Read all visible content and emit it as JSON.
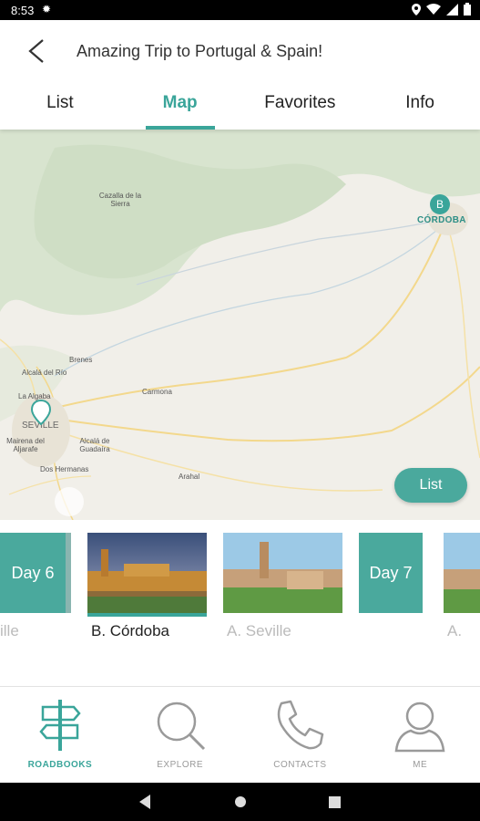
{
  "status": {
    "time": "8:53"
  },
  "header": {
    "title": "Amazing Trip to Portugal & Spain!"
  },
  "tabs": [
    {
      "label": "List"
    },
    {
      "label": "Map"
    },
    {
      "label": "Favorites"
    },
    {
      "label": "Info"
    }
  ],
  "map": {
    "labels": {
      "cazalla": "Cazalla de la Sierra",
      "brenes": "Brenes",
      "alcala_rio": "Alcalá del Río",
      "la_algaba": "La Algaba",
      "seville": "SEVILLE",
      "carmona": "Carmona",
      "mairena": "Mairena del Aljarafe",
      "alcala_guadaira": "Alcalá de Guadaíra",
      "dos_hermanas": "Dos Hermanas",
      "arahal": "Arahal"
    },
    "pin_b_letter": "B",
    "pin_b_city": "CÓRDOBA",
    "list_button": "List"
  },
  "carousel": {
    "day6": "Day 6",
    "day7": "Day 7",
    "captions": {
      "prev": "ille",
      "cordoba": "B. Córdoba",
      "seville": "A. Seville",
      "next": "A."
    }
  },
  "bottom_nav": [
    {
      "label": "ROADBOOKS"
    },
    {
      "label": "EXPLORE"
    },
    {
      "label": "CONTACTS"
    },
    {
      "label": "ME"
    }
  ],
  "colors": {
    "accent": "#3aa59a",
    "accent_light": "#4aa99d"
  }
}
